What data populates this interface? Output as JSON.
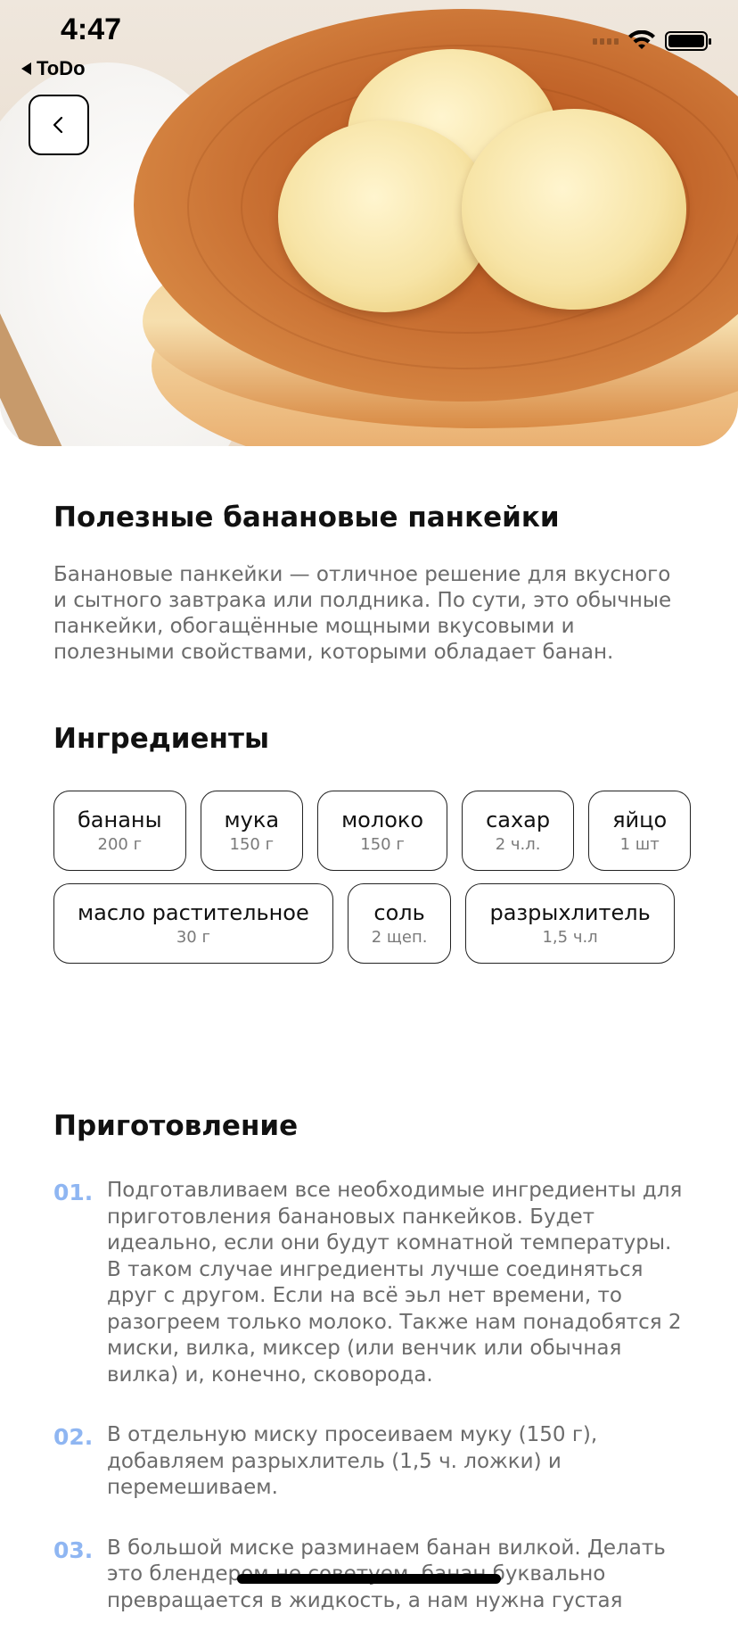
{
  "status_bar": {
    "time": "4:47",
    "back_app_label": "ToDo",
    "icons": [
      "signal-icon",
      "wifi-icon",
      "battery-icon"
    ]
  },
  "nav": {
    "back_icon": "chevron-left-icon"
  },
  "hero": {
    "image": "banana-pancakes-photo"
  },
  "recipe": {
    "title": "Полезные банановые панкейки",
    "description": "Банановые панкейки — отличное решение для вкусного и сытного завтрака или полдника. По сути, это обычные панкейки, обогащённые мощными вкусовыми и полезными свойствами, которыми обладает банан."
  },
  "ingredients": {
    "title": "Ингредиенты",
    "items": [
      {
        "name": "бананы",
        "amount": "200 г"
      },
      {
        "name": "мука",
        "amount": "150 г"
      },
      {
        "name": "молоко",
        "amount": "150 г"
      },
      {
        "name": "сахар",
        "amount": "2 ч.л."
      },
      {
        "name": "яйцо",
        "amount": "1 шт"
      },
      {
        "name": "масло растительное",
        "amount": "30 г"
      },
      {
        "name": "соль",
        "amount": "2 щеп."
      },
      {
        "name": "разрыхлитель",
        "amount": "1,5 ч.л"
      }
    ]
  },
  "preparation": {
    "title": "Приготовление",
    "steps": [
      {
        "number": "01.",
        "text": "Подготавливаем все необходимые ингредиенты для приготовления банановых панкейков. Будет идеально, если они будут комнатной температуры. В таком случае ингредиенты лучше соединяться друг с другом. Если на всё эьл нет времени, то разогреем только молоко. Также нам понадобятся 2 миски, вилка, миксер (или венчик или обычная вилка) и, конечно, сковорода."
      },
      {
        "number": "02.",
        "text": "В отдельную миску просеиваем муку (150 г), добавляем разрыхлитель (1,5 ч. ложки) и перемешиваем."
      },
      {
        "number": "03.",
        "text": "В большой миске разминаем банан вилкой. Делать это блендером не советуем, банан буквально превращается в жидкость, а нам нужна густая"
      }
    ]
  },
  "colors": {
    "step_number": "#8fb6f2",
    "body_text": "#6b6b6b",
    "heading": "#111111"
  }
}
